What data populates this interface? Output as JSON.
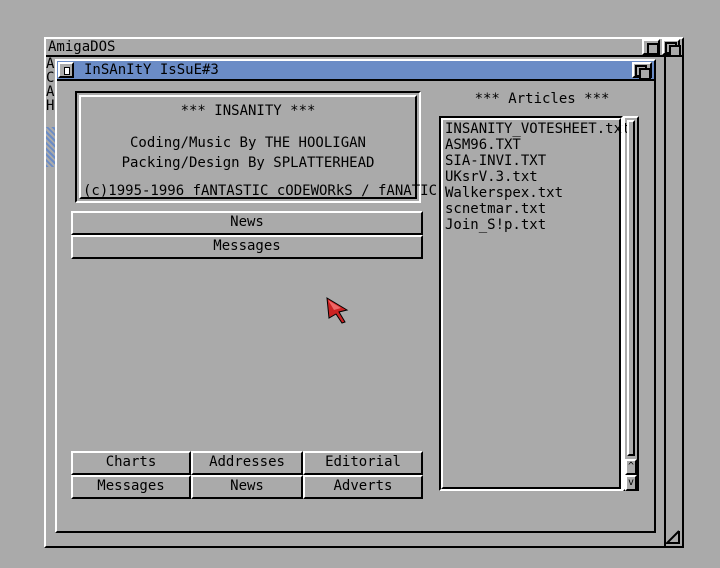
{
  "back_window": {
    "title": "AmigaDOS",
    "side_letters": [
      "A",
      "C",
      "A",
      "H"
    ]
  },
  "window": {
    "title": "InSAnItY IsSuE#3",
    "info": {
      "heading": "*** INSANITY ***",
      "line1": "Coding/Music By THE HOOLIGAN",
      "line2": "Packing/Design By SPLATTERHEAD",
      "line3": "(c)1995-1996 fANTASTIC cODEWORkS / fANATIC"
    },
    "top_buttons": [
      "News",
      "Messages"
    ],
    "bottom_buttons": [
      [
        "Charts",
        "Addresses",
        "Editorial"
      ],
      [
        "Messages",
        "News",
        "Adverts"
      ]
    ],
    "articles": {
      "heading": "*** Articles ***",
      "items": [
        "INSANITY_VOTESHEET.txt",
        "ASM96.TXT",
        "SIA-INVI.TXT",
        "UKsrV.3.txt",
        "Walkerspex.txt",
        "scnetmar.txt",
        "Join_S!p.txt"
      ]
    },
    "scroll": {
      "up": "^",
      "down": "v"
    }
  },
  "colors": {
    "background": "#aaaaaa",
    "titlebar": "#6b8cc6",
    "pointer": "#cc2222"
  }
}
